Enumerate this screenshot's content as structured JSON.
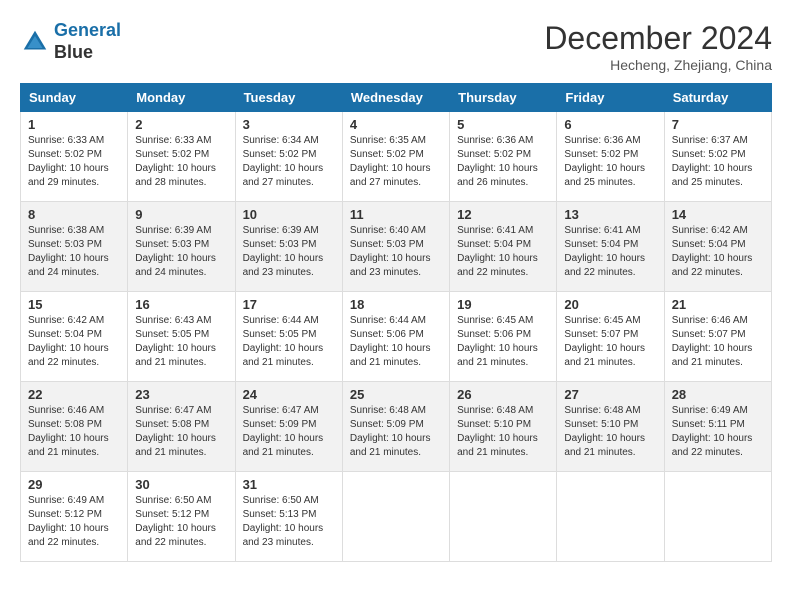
{
  "header": {
    "logo_line1": "General",
    "logo_line2": "Blue",
    "month": "December 2024",
    "location": "Hecheng, Zhejiang, China"
  },
  "weekdays": [
    "Sunday",
    "Monday",
    "Tuesday",
    "Wednesday",
    "Thursday",
    "Friday",
    "Saturday"
  ],
  "weeks": [
    [
      {
        "day": "1",
        "info": "Sunrise: 6:33 AM\nSunset: 5:02 PM\nDaylight: 10 hours\nand 29 minutes."
      },
      {
        "day": "2",
        "info": "Sunrise: 6:33 AM\nSunset: 5:02 PM\nDaylight: 10 hours\nand 28 minutes."
      },
      {
        "day": "3",
        "info": "Sunrise: 6:34 AM\nSunset: 5:02 PM\nDaylight: 10 hours\nand 27 minutes."
      },
      {
        "day": "4",
        "info": "Sunrise: 6:35 AM\nSunset: 5:02 PM\nDaylight: 10 hours\nand 27 minutes."
      },
      {
        "day": "5",
        "info": "Sunrise: 6:36 AM\nSunset: 5:02 PM\nDaylight: 10 hours\nand 26 minutes."
      },
      {
        "day": "6",
        "info": "Sunrise: 6:36 AM\nSunset: 5:02 PM\nDaylight: 10 hours\nand 25 minutes."
      },
      {
        "day": "7",
        "info": "Sunrise: 6:37 AM\nSunset: 5:02 PM\nDaylight: 10 hours\nand 25 minutes."
      }
    ],
    [
      {
        "day": "8",
        "info": "Sunrise: 6:38 AM\nSunset: 5:03 PM\nDaylight: 10 hours\nand 24 minutes."
      },
      {
        "day": "9",
        "info": "Sunrise: 6:39 AM\nSunset: 5:03 PM\nDaylight: 10 hours\nand 24 minutes."
      },
      {
        "day": "10",
        "info": "Sunrise: 6:39 AM\nSunset: 5:03 PM\nDaylight: 10 hours\nand 23 minutes."
      },
      {
        "day": "11",
        "info": "Sunrise: 6:40 AM\nSunset: 5:03 PM\nDaylight: 10 hours\nand 23 minutes."
      },
      {
        "day": "12",
        "info": "Sunrise: 6:41 AM\nSunset: 5:04 PM\nDaylight: 10 hours\nand 22 minutes."
      },
      {
        "day": "13",
        "info": "Sunrise: 6:41 AM\nSunset: 5:04 PM\nDaylight: 10 hours\nand 22 minutes."
      },
      {
        "day": "14",
        "info": "Sunrise: 6:42 AM\nSunset: 5:04 PM\nDaylight: 10 hours\nand 22 minutes."
      }
    ],
    [
      {
        "day": "15",
        "info": "Sunrise: 6:42 AM\nSunset: 5:04 PM\nDaylight: 10 hours\nand 22 minutes."
      },
      {
        "day": "16",
        "info": "Sunrise: 6:43 AM\nSunset: 5:05 PM\nDaylight: 10 hours\nand 21 minutes."
      },
      {
        "day": "17",
        "info": "Sunrise: 6:44 AM\nSunset: 5:05 PM\nDaylight: 10 hours\nand 21 minutes."
      },
      {
        "day": "18",
        "info": "Sunrise: 6:44 AM\nSunset: 5:06 PM\nDaylight: 10 hours\nand 21 minutes."
      },
      {
        "day": "19",
        "info": "Sunrise: 6:45 AM\nSunset: 5:06 PM\nDaylight: 10 hours\nand 21 minutes."
      },
      {
        "day": "20",
        "info": "Sunrise: 6:45 AM\nSunset: 5:07 PM\nDaylight: 10 hours\nand 21 minutes."
      },
      {
        "day": "21",
        "info": "Sunrise: 6:46 AM\nSunset: 5:07 PM\nDaylight: 10 hours\nand 21 minutes."
      }
    ],
    [
      {
        "day": "22",
        "info": "Sunrise: 6:46 AM\nSunset: 5:08 PM\nDaylight: 10 hours\nand 21 minutes."
      },
      {
        "day": "23",
        "info": "Sunrise: 6:47 AM\nSunset: 5:08 PM\nDaylight: 10 hours\nand 21 minutes."
      },
      {
        "day": "24",
        "info": "Sunrise: 6:47 AM\nSunset: 5:09 PM\nDaylight: 10 hours\nand 21 minutes."
      },
      {
        "day": "25",
        "info": "Sunrise: 6:48 AM\nSunset: 5:09 PM\nDaylight: 10 hours\nand 21 minutes."
      },
      {
        "day": "26",
        "info": "Sunrise: 6:48 AM\nSunset: 5:10 PM\nDaylight: 10 hours\nand 21 minutes."
      },
      {
        "day": "27",
        "info": "Sunrise: 6:48 AM\nSunset: 5:10 PM\nDaylight: 10 hours\nand 21 minutes."
      },
      {
        "day": "28",
        "info": "Sunrise: 6:49 AM\nSunset: 5:11 PM\nDaylight: 10 hours\nand 22 minutes."
      }
    ],
    [
      {
        "day": "29",
        "info": "Sunrise: 6:49 AM\nSunset: 5:12 PM\nDaylight: 10 hours\nand 22 minutes."
      },
      {
        "day": "30",
        "info": "Sunrise: 6:50 AM\nSunset: 5:12 PM\nDaylight: 10 hours\nand 22 minutes."
      },
      {
        "day": "31",
        "info": "Sunrise: 6:50 AM\nSunset: 5:13 PM\nDaylight: 10 hours\nand 23 minutes."
      },
      {
        "day": "",
        "info": ""
      },
      {
        "day": "",
        "info": ""
      },
      {
        "day": "",
        "info": ""
      },
      {
        "day": "",
        "info": ""
      }
    ]
  ]
}
